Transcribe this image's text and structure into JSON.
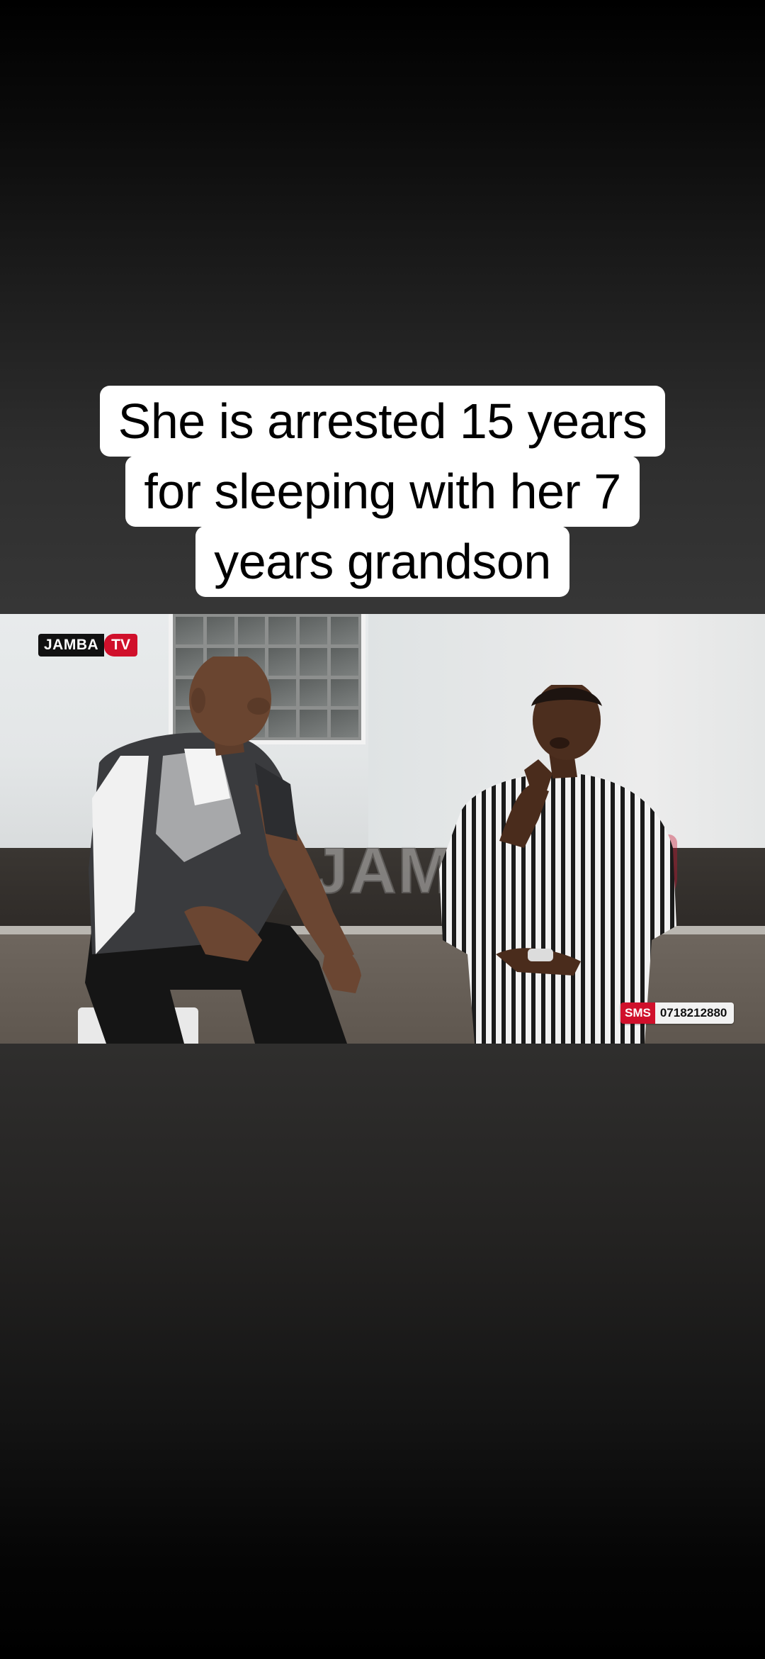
{
  "caption": {
    "lines": [
      "She is arrested 15 years",
      "for sleeping with her  7",
      "years grandson"
    ]
  },
  "video": {
    "logo": {
      "brand": "JAMBA",
      "tv": "TV"
    },
    "watermark": {
      "brand": "JAMBA",
      "tv": "TV"
    },
    "sms": {
      "label": "SMS",
      "number": "0718212880"
    }
  },
  "colors": {
    "brand_red": "#d0102b",
    "caption_bg": "#ffffff",
    "caption_text": "#000000"
  }
}
